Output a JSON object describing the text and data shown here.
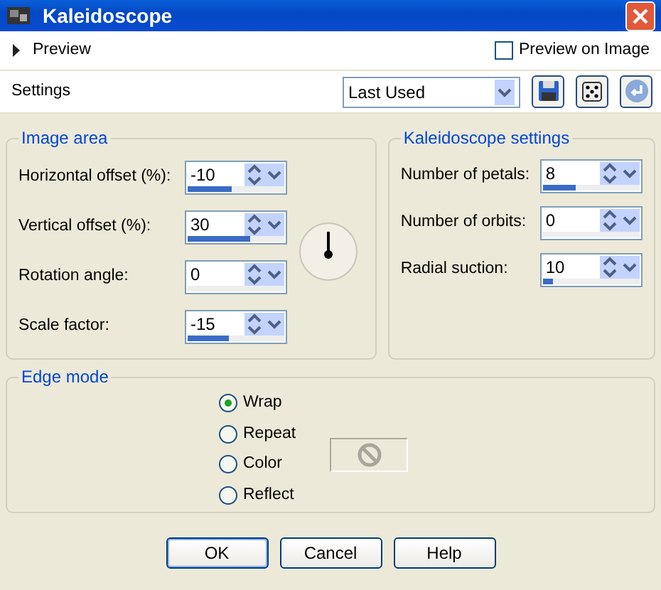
{
  "window": {
    "title": "Kaleidoscope"
  },
  "preview": {
    "label": "Preview",
    "expanded": false,
    "checkbox": {
      "label": "Preview on Image",
      "checked": false
    }
  },
  "settings": {
    "label": "Settings",
    "preset": "Last Used"
  },
  "image_area": {
    "title": "Image area",
    "fields": [
      {
        "label": "Horizontal offset (%):",
        "value": "-10",
        "level": 0.45
      },
      {
        "label": "Vertical offset (%):",
        "value": "30",
        "level": 0.64
      },
      {
        "label": "Rotation angle:",
        "value": "0",
        "level": 0
      },
      {
        "label": "Scale factor:",
        "value": "-15",
        "level": 0.42
      }
    ]
  },
  "kaleidoscope_settings": {
    "title": "Kaleidoscope settings",
    "fields": [
      {
        "label": "Number of petals:",
        "value": "8",
        "level": 0.34
      },
      {
        "label": "Number of orbits:",
        "value": "0",
        "level": 0
      },
      {
        "label": "Radial suction:",
        "value": "10",
        "level": 0.1
      }
    ]
  },
  "edge_mode": {
    "title": "Edge mode",
    "options": [
      {
        "label": "Wrap",
        "selected": true
      },
      {
        "label": "Repeat",
        "selected": false
      },
      {
        "label": "Color",
        "selected": false
      },
      {
        "label": "Reflect",
        "selected": false
      }
    ]
  },
  "buttons": [
    "OK",
    "Cancel",
    "Help"
  ]
}
